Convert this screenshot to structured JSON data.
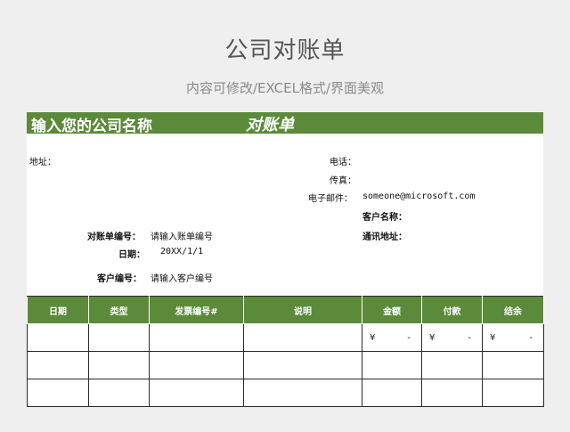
{
  "page": {
    "title": "公司对账单",
    "subtitle": "内容可修改/EXCEL格式/界面美观"
  },
  "header": {
    "company_name": "输入您的公司名称",
    "statement_title": "对账单"
  },
  "contact": {
    "address_label": "地址：",
    "phone_label": "电话：",
    "fax_label": "传真：",
    "email_label": "电子邮件：",
    "email_value": "someone@microsoft.com",
    "customer_name_label": "客户名称：",
    "mailing_address_label": "通讯地址："
  },
  "statement_info": {
    "number_label": "对账单编号：",
    "number_value": "请输入账单编号",
    "date_label": "日期：",
    "date_value": "20XX/1/1",
    "customer_no_label": "客户编号：",
    "customer_no_value": "请输入客户编号"
  },
  "ledger": {
    "columns": [
      "日期",
      "类型",
      "发票编号#",
      "说明",
      "金额",
      "付款",
      "结余"
    ],
    "rows": [
      {
        "amount": [
          "¥",
          "-"
        ],
        "payment": [
          "¥",
          "-"
        ],
        "balance": [
          "¥",
          "-"
        ]
      },
      {},
      {}
    ]
  },
  "colors": {
    "accent": "#5a8a3a",
    "background": "#efefef"
  }
}
